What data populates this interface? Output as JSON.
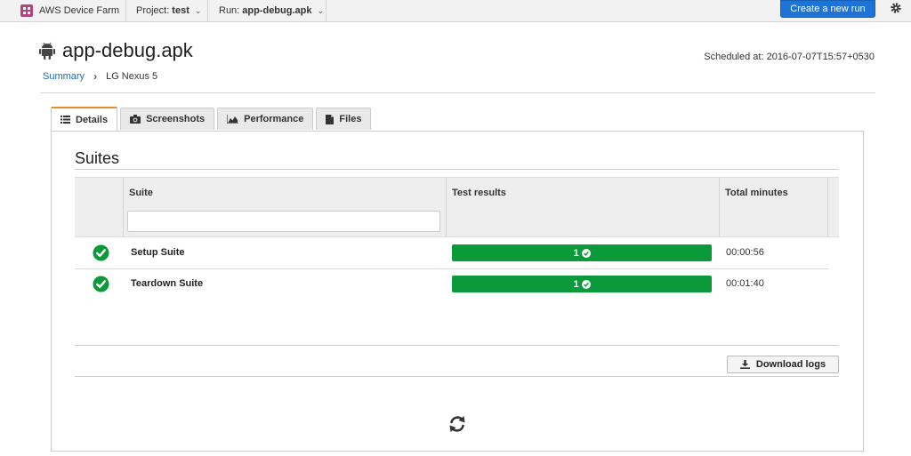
{
  "topbar": {
    "app_name": "AWS Device Farm",
    "project_prefix": "Project:",
    "project_value": "test",
    "run_prefix": "Run:",
    "run_value": "app-debug.apk",
    "create_button": "Create a new run"
  },
  "header": {
    "title": "app-debug.apk",
    "scheduled": "Scheduled at: 2016-07-07T15:57+0530",
    "breadcrumb": {
      "summary": "Summary",
      "device": "LG Nexus 5"
    }
  },
  "tabs": [
    {
      "label": "Details",
      "icon": "list-icon",
      "active": true
    },
    {
      "label": "Screenshots",
      "icon": "camera-icon"
    },
    {
      "label": "Performance",
      "icon": "area-chart-icon"
    },
    {
      "label": "Files",
      "icon": "file-icon"
    }
  ],
  "suites": {
    "heading": "Suites",
    "columns": {
      "suite": "Suite",
      "results": "Test results",
      "minutes": "Total minutes"
    },
    "filter_value": "",
    "rows": [
      {
        "name": "Setup Suite",
        "passed": "1",
        "minutes": "00:00:56",
        "status": "passed"
      },
      {
        "name": "Teardown Suite",
        "passed": "1",
        "minutes": "00:01:40",
        "status": "passed"
      }
    ],
    "download_button": "Download logs"
  },
  "colors": {
    "pass_green": "#0a9a3a",
    "accent_blue": "#1e74d6",
    "tab_accent": "#e68a2e"
  }
}
